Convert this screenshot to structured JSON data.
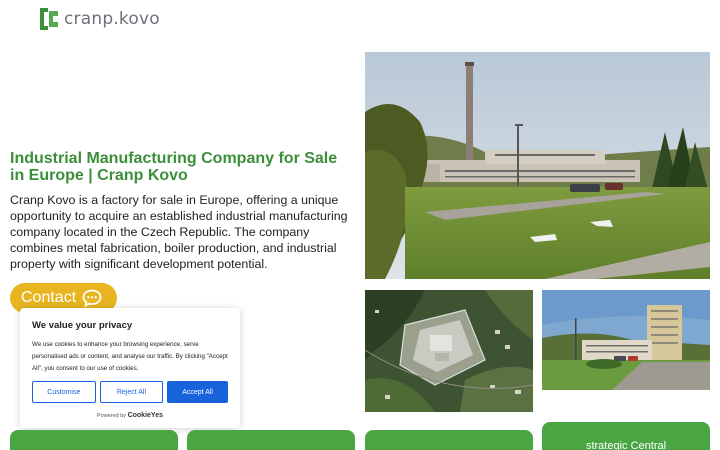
{
  "header": {
    "logo_text": "cranp.kovo",
    "logo_color": "#3c8f3a"
  },
  "hero": {
    "title": "Industrial Manufacturing Company for Sale in Europe | Cranp Kovo",
    "description": "Cranp Kovo is a factory for sale in Europe, offering a unique opportunity to acquire an established industrial manufacturing company located in the Czech Republic. The company combines metal fabrication, boiler production, and industrial property with significant development potential.",
    "contact_label": "Contact",
    "contact_icon": "chat-bubble-icon",
    "accent": "#e8b521"
  },
  "images": {
    "main": "factory-grounds-photo",
    "aerial": "aerial-map-photo",
    "building": "office-building-photo"
  },
  "cookie_banner": {
    "title": "We value your privacy",
    "text": "We use cookies to enhance your browsing experience, serve personalised ads or content, and analyse our traffic. By clicking \"Accept All\", you consent to our use of cookies.",
    "customise_label": "Customise",
    "reject_label": "Reject All",
    "accept_label": "Accept All",
    "powered_by": "Powered by",
    "brand": "CookieYes",
    "accent": "#1863dc"
  },
  "cards": {
    "color": "#4aa642",
    "card4_text": "strategic Central"
  }
}
